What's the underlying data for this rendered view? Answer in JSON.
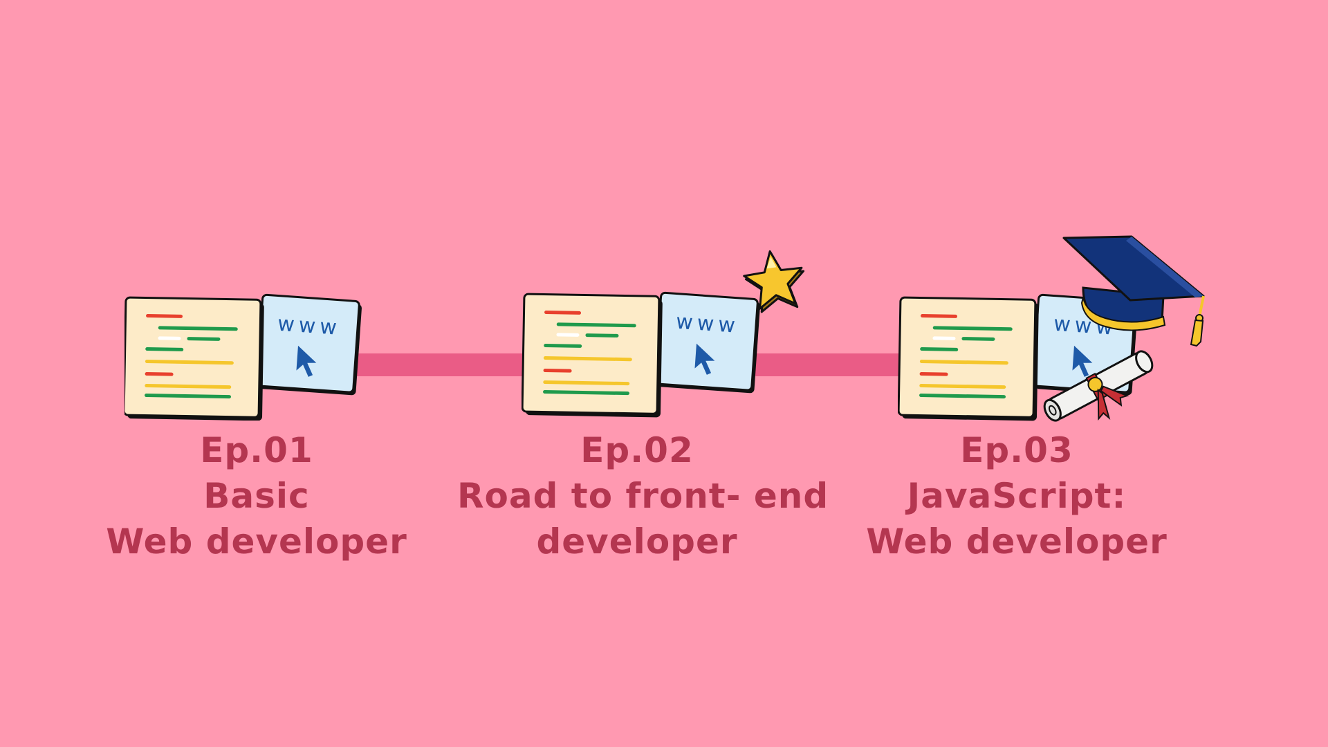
{
  "colors": {
    "background": "#ff99b1",
    "connector": "#ea5c86",
    "label_text": "#b43650",
    "code_panel": "#fdebc8",
    "browser_panel": "#d4ebf9",
    "code_red": "#e8402d",
    "code_green": "#1f9a4c",
    "code_yellow": "#f5c62c",
    "www_blue": "#1e5aa8"
  },
  "browser_text": "www",
  "episodes": [
    {
      "number": "Ep.01",
      "title_line_1": "Basic",
      "title_line_2": "Web developer",
      "decoration": "none"
    },
    {
      "number": "Ep.02",
      "title_line_1": "Road to front- end",
      "title_line_2": "developer",
      "decoration": "star-icon"
    },
    {
      "number": "Ep.03",
      "title_line_1": "JavaScript:",
      "title_line_2": "Web developer",
      "decoration": "graduation-cap-icon, diploma-scroll-icon"
    }
  ]
}
